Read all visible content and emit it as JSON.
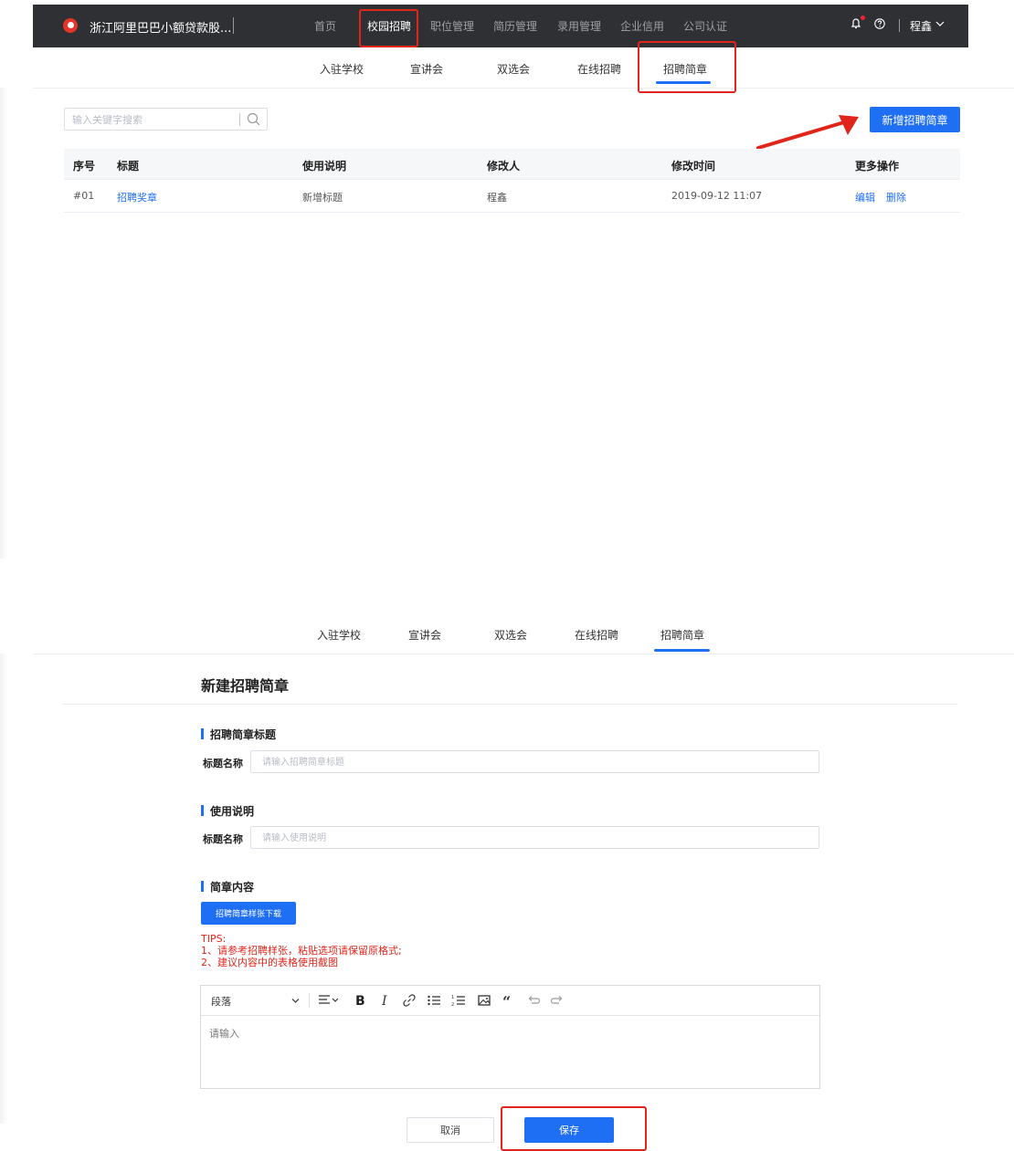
{
  "header": {
    "company": "浙江阿里巴巴小额贷款股...",
    "nav": [
      "首页",
      "校园招聘",
      "职位管理",
      "简历管理",
      "录用管理",
      "企业信用",
      "公司认证"
    ],
    "active_nav": "校园招聘",
    "user": "程鑫"
  },
  "subnav": {
    "items": [
      "入驻学校",
      "宣讲会",
      "双选会",
      "在线招聘",
      "招聘简章"
    ],
    "active": "招聘简章"
  },
  "list_page": {
    "search_placeholder": "输入关键字搜索",
    "add_button": "新增招聘简章",
    "columns": [
      "序号",
      "标题",
      "使用说明",
      "修改人",
      "修改时间",
      "更多操作"
    ],
    "rows": [
      {
        "index": "#01",
        "title": "招聘奖章",
        "description": "新增标题",
        "modifier": "程鑫",
        "time": "2019-09-12 11:07",
        "edit": "编辑",
        "delete": "删除"
      }
    ]
  },
  "form_page": {
    "title": "新建招聘简章",
    "section_title": "招聘简章标题",
    "title_label": "标题名称",
    "title_placeholder": "请输入招聘简章标题",
    "section_usage": "使用说明",
    "usage_label": "标题名称",
    "usage_placeholder": "请输入使用说明",
    "section_content": "简章内容",
    "download_button": "招聘简章样张下载",
    "tips": [
      "TIPS:",
      "1、请参考招聘样张，粘贴选项请保留原格式;",
      "2、建议内容中的表格使用截图"
    ],
    "editor": {
      "paragraph_select": "段落",
      "placeholder": "请输入"
    },
    "cancel_button": "取消",
    "save_button": "保存"
  },
  "colors": {
    "primary": "#1f6ff5",
    "highlight": "#e1251b",
    "topbar": "#2f3033"
  }
}
